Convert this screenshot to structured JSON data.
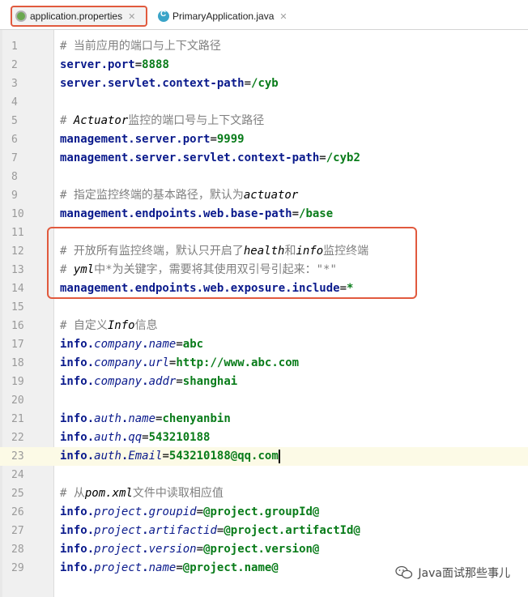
{
  "tabs": [
    {
      "label": "application.properties",
      "active": true
    },
    {
      "label": "PrimaryApplication.java",
      "active": false
    }
  ],
  "lines": [
    {
      "n": "1",
      "segs": [
        {
          "t": "# 当前应用的端口与上下文路径",
          "s": "c"
        }
      ]
    },
    {
      "n": "2",
      "segs": [
        {
          "t": "server.port",
          "s": "k"
        },
        {
          "t": "=",
          "s": "eq"
        },
        {
          "t": "8888",
          "s": "v"
        }
      ]
    },
    {
      "n": "3",
      "segs": [
        {
          "t": "server.servlet.context-path",
          "s": "k"
        },
        {
          "t": "=",
          "s": "eq"
        },
        {
          "t": "/cyb",
          "s": "v"
        }
      ]
    },
    {
      "n": "4",
      "segs": []
    },
    {
      "n": "5",
      "segs": [
        {
          "t": "# ",
          "s": "c"
        },
        {
          "t": "Actuator",
          "s": "ci"
        },
        {
          "t": "监控的端口号与上下文路径",
          "s": "c"
        }
      ]
    },
    {
      "n": "6",
      "segs": [
        {
          "t": "management.server.port",
          "s": "k"
        },
        {
          "t": "=",
          "s": "eq"
        },
        {
          "t": "9999",
          "s": "v"
        }
      ]
    },
    {
      "n": "7",
      "segs": [
        {
          "t": "management.server.servlet.context-path",
          "s": "k"
        },
        {
          "t": "=",
          "s": "eq"
        },
        {
          "t": "/cyb2",
          "s": "v"
        }
      ]
    },
    {
      "n": "8",
      "segs": []
    },
    {
      "n": "9",
      "segs": [
        {
          "t": "# 指定监控终端的基本路径，默认为",
          "s": "c"
        },
        {
          "t": "actuator",
          "s": "ci"
        }
      ]
    },
    {
      "n": "10",
      "segs": [
        {
          "t": "management.endpoints.web.base-path",
          "s": "k"
        },
        {
          "t": "=",
          "s": "eq"
        },
        {
          "t": "/base",
          "s": "v"
        }
      ]
    },
    {
      "n": "11",
      "segs": []
    },
    {
      "n": "12",
      "segs": [
        {
          "t": "# 开放所有监控终端，默认只开启了",
          "s": "c"
        },
        {
          "t": "health",
          "s": "ci"
        },
        {
          "t": "和",
          "s": "c"
        },
        {
          "t": "info",
          "s": "ci"
        },
        {
          "t": "监控终端",
          "s": "c"
        }
      ]
    },
    {
      "n": "13",
      "segs": [
        {
          "t": "# ",
          "s": "c"
        },
        {
          "t": "yml",
          "s": "ci"
        },
        {
          "t": "中*为关键字，需要将其使用双引号引起来：\"*\"",
          "s": "c"
        }
      ]
    },
    {
      "n": "14",
      "segs": [
        {
          "t": "management.endpoints.web.exposure.include",
          "s": "k"
        },
        {
          "t": "=",
          "s": "eq"
        },
        {
          "t": "*",
          "s": "v"
        }
      ]
    },
    {
      "n": "15",
      "segs": []
    },
    {
      "n": "16",
      "segs": [
        {
          "t": "# 自定义",
          "s": "c"
        },
        {
          "t": "Info",
          "s": "ci"
        },
        {
          "t": "信息",
          "s": "c"
        }
      ]
    },
    {
      "n": "17",
      "segs": [
        {
          "t": "info.",
          "s": "k"
        },
        {
          "t": "company",
          "s": "ki"
        },
        {
          "t": ".",
          "s": "k"
        },
        {
          "t": "name",
          "s": "ki"
        },
        {
          "t": "=",
          "s": "eq"
        },
        {
          "t": "abc",
          "s": "v"
        }
      ]
    },
    {
      "n": "18",
      "segs": [
        {
          "t": "info.",
          "s": "k"
        },
        {
          "t": "company",
          "s": "ki"
        },
        {
          "t": ".",
          "s": "k"
        },
        {
          "t": "url",
          "s": "ki"
        },
        {
          "t": "=",
          "s": "eq"
        },
        {
          "t": "http://www.abc.com",
          "s": "v"
        }
      ]
    },
    {
      "n": "19",
      "segs": [
        {
          "t": "info.",
          "s": "k"
        },
        {
          "t": "company",
          "s": "ki"
        },
        {
          "t": ".",
          "s": "k"
        },
        {
          "t": "addr",
          "s": "ki"
        },
        {
          "t": "=",
          "s": "eq"
        },
        {
          "t": "shanghai",
          "s": "v"
        }
      ]
    },
    {
      "n": "20",
      "segs": []
    },
    {
      "n": "21",
      "segs": [
        {
          "t": "info.",
          "s": "k"
        },
        {
          "t": "auth",
          "s": "ki"
        },
        {
          "t": ".",
          "s": "k"
        },
        {
          "t": "name",
          "s": "ki"
        },
        {
          "t": "=",
          "s": "eq"
        },
        {
          "t": "chenyanbin",
          "s": "v"
        }
      ]
    },
    {
      "n": "22",
      "segs": [
        {
          "t": "info.",
          "s": "k"
        },
        {
          "t": "auth",
          "s": "ki"
        },
        {
          "t": ".",
          "s": "k"
        },
        {
          "t": "qq",
          "s": "ki"
        },
        {
          "t": "=",
          "s": "eq"
        },
        {
          "t": "543210188",
          "s": "v"
        }
      ]
    },
    {
      "n": "23",
      "segs": [
        {
          "t": "info.",
          "s": "k"
        },
        {
          "t": "auth",
          "s": "ki"
        },
        {
          "t": ".",
          "s": "k"
        },
        {
          "t": "Email",
          "s": "ki"
        },
        {
          "t": "=",
          "s": "eq"
        },
        {
          "t": "543210188@qq.com",
          "s": "v"
        }
      ],
      "current": true
    },
    {
      "n": "24",
      "segs": []
    },
    {
      "n": "25",
      "segs": [
        {
          "t": "# 从",
          "s": "c"
        },
        {
          "t": "pom.xml",
          "s": "ci"
        },
        {
          "t": "文件中读取相应值",
          "s": "c"
        }
      ]
    },
    {
      "n": "26",
      "segs": [
        {
          "t": "info.",
          "s": "k"
        },
        {
          "t": "project",
          "s": "ki"
        },
        {
          "t": ".",
          "s": "k"
        },
        {
          "t": "groupid",
          "s": "ki"
        },
        {
          "t": "=",
          "s": "eq"
        },
        {
          "t": "@project.groupId@",
          "s": "v"
        }
      ]
    },
    {
      "n": "27",
      "segs": [
        {
          "t": "info.",
          "s": "k"
        },
        {
          "t": "project",
          "s": "ki"
        },
        {
          "t": ".",
          "s": "k"
        },
        {
          "t": "artifactid",
          "s": "ki"
        },
        {
          "t": "=",
          "s": "eq"
        },
        {
          "t": "@project.artifactId@",
          "s": "v"
        }
      ]
    },
    {
      "n": "28",
      "segs": [
        {
          "t": "info.",
          "s": "k"
        },
        {
          "t": "project",
          "s": "ki"
        },
        {
          "t": ".",
          "s": "k"
        },
        {
          "t": "version",
          "s": "ki"
        },
        {
          "t": "=",
          "s": "eq"
        },
        {
          "t": "@project.version@",
          "s": "v"
        }
      ]
    },
    {
      "n": "29",
      "segs": [
        {
          "t": "info.",
          "s": "k"
        },
        {
          "t": "project",
          "s": "ki"
        },
        {
          "t": ".",
          "s": "k"
        },
        {
          "t": "name",
          "s": "ki"
        },
        {
          "t": "=",
          "s": "eq"
        },
        {
          "t": "@project.name@",
          "s": "v"
        }
      ]
    }
  ],
  "watermark": {
    "text": "Java面试那些事儿",
    "icon": "wechat-icon"
  },
  "colors": {
    "highlight_box": "#e15a3e",
    "keyword": "#0a1a8c",
    "value": "#097c1a",
    "comment": "#7f7f7f",
    "current_line": "#fcfae6"
  }
}
